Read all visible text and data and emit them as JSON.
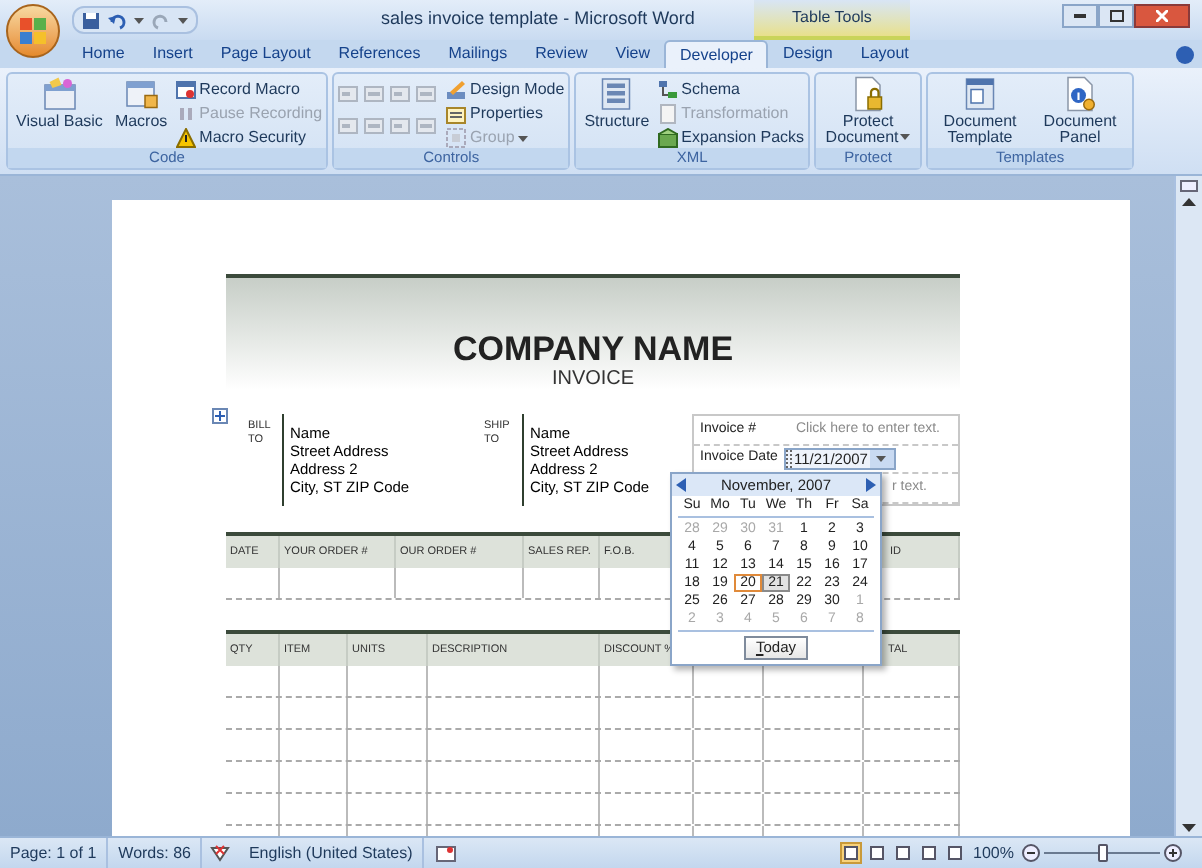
{
  "window": {
    "title": "sales invoice template - Microsoft Word",
    "context_tab": "Table Tools"
  },
  "tabs": [
    {
      "label": "Home",
      "selected": false
    },
    {
      "label": "Insert",
      "selected": false
    },
    {
      "label": "Page Layout",
      "selected": false
    },
    {
      "label": "References",
      "selected": false
    },
    {
      "label": "Mailings",
      "selected": false
    },
    {
      "label": "Review",
      "selected": false
    },
    {
      "label": "View",
      "selected": false
    },
    {
      "label": "Developer",
      "selected": true
    },
    {
      "label": "Design",
      "selected": false
    },
    {
      "label": "Layout",
      "selected": false
    }
  ],
  "ribbon_groups": [
    {
      "label": "Code",
      "items": [
        {
          "label": "Visual Basic",
          "kind": "large",
          "disabled": false,
          "dropdown": false
        },
        {
          "label": "Macros",
          "kind": "large",
          "disabled": false,
          "dropdown": false
        },
        {
          "label": "Record Macro",
          "kind": "small",
          "disabled": false,
          "dropdown": false
        },
        {
          "label": "Pause Recording",
          "kind": "small",
          "disabled": true,
          "dropdown": false
        },
        {
          "label": "Macro Security",
          "kind": "small",
          "disabled": false,
          "dropdown": false
        }
      ]
    },
    {
      "label": "Controls",
      "items": [
        {
          "kind": "control_grid"
        },
        {
          "label": "Design Mode",
          "kind": "small",
          "disabled": false,
          "dropdown": false
        },
        {
          "label": "Properties",
          "kind": "small",
          "disabled": false,
          "dropdown": false
        },
        {
          "label": "Group",
          "kind": "small",
          "disabled": true,
          "dropdown": true
        }
      ]
    },
    {
      "label": "XML",
      "items": [
        {
          "label": "Structure",
          "kind": "large",
          "disabled": false,
          "dropdown": false
        },
        {
          "label": "Schema",
          "kind": "small",
          "disabled": false,
          "dropdown": false
        },
        {
          "label": "Transformation",
          "kind": "small",
          "disabled": true,
          "dropdown": false
        },
        {
          "label": "Expansion Packs",
          "kind": "small",
          "disabled": false,
          "dropdown": false
        }
      ]
    },
    {
      "label": "Protect",
      "items": [
        {
          "label": "Protect Document",
          "kind": "large",
          "disabled": false,
          "dropdown": true
        }
      ]
    },
    {
      "label": "Templates",
      "items": [
        {
          "label": "Document Template",
          "kind": "large",
          "disabled": false,
          "dropdown": false
        },
        {
          "label": "Document Panel",
          "kind": "large",
          "disabled": false,
          "dropdown": false
        }
      ]
    }
  ],
  "document": {
    "company_name": "COMPANY NAME",
    "title": "INVOICE",
    "bill_to": {
      "label": "BILL TO",
      "lines": [
        "Name",
        "Street Address",
        "Address 2",
        "City, ST  ZIP Code"
      ]
    },
    "ship_to": {
      "label": "SHIP TO",
      "lines": [
        "Name",
        "Street Address",
        "Address 2",
        "City, ST  ZIP Code"
      ]
    },
    "invoice_fields": [
      {
        "label": "Invoice #",
        "value": "Click here to enter text.",
        "kind": "text"
      },
      {
        "label": "Invoice Date",
        "value": "11/21/2007",
        "kind": "date"
      },
      {
        "value": "r text.",
        "kind": "text"
      }
    ],
    "order_table": {
      "columns": [
        "DATE",
        "YOUR ORDER #",
        "OUR ORDER #",
        "SALES REP.",
        "F.O.B.",
        null,
        "ID"
      ]
    },
    "items_table": {
      "columns": [
        "QTY",
        "ITEM",
        "UNITS",
        "DESCRIPTION",
        "DISCOUNT %",
        null,
        null,
        "TAL"
      ]
    }
  },
  "date_picker": {
    "month": "November, 2007",
    "weekdays": [
      "Su",
      "Mo",
      "Tu",
      "We",
      "Th",
      "Fr",
      "Sa"
    ],
    "today_button": "Today",
    "weeks": [
      [
        {
          "day": "28",
          "outside": true,
          "selected": false,
          "today": false
        },
        {
          "day": "29",
          "outside": true,
          "selected": false,
          "today": false
        },
        {
          "day": "30",
          "outside": true,
          "selected": false,
          "today": false
        },
        {
          "day": "31",
          "outside": true,
          "selected": false,
          "today": false
        },
        {
          "day": "1",
          "outside": false,
          "selected": false,
          "today": false
        },
        {
          "day": "2",
          "outside": false,
          "selected": false,
          "today": false
        },
        {
          "day": "3",
          "outside": false,
          "selected": false,
          "today": false
        }
      ],
      [
        {
          "day": "4",
          "outside": false,
          "selected": false,
          "today": false
        },
        {
          "day": "5",
          "outside": false,
          "selected": false,
          "today": false
        },
        {
          "day": "6",
          "outside": false,
          "selected": false,
          "today": false
        },
        {
          "day": "7",
          "outside": false,
          "selected": false,
          "today": false
        },
        {
          "day": "8",
          "outside": false,
          "selected": false,
          "today": false
        },
        {
          "day": "9",
          "outside": false,
          "selected": false,
          "today": false
        },
        {
          "day": "10",
          "outside": false,
          "selected": false,
          "today": false
        }
      ],
      [
        {
          "day": "11",
          "outside": false,
          "selected": false,
          "today": false
        },
        {
          "day": "12",
          "outside": false,
          "selected": false,
          "today": false
        },
        {
          "day": "13",
          "outside": false,
          "selected": false,
          "today": false
        },
        {
          "day": "14",
          "outside": false,
          "selected": false,
          "today": false
        },
        {
          "day": "15",
          "outside": false,
          "selected": false,
          "today": false
        },
        {
          "day": "16",
          "outside": false,
          "selected": false,
          "today": false
        },
        {
          "day": "17",
          "outside": false,
          "selected": false,
          "today": false
        }
      ],
      [
        {
          "day": "18",
          "outside": false,
          "selected": false,
          "today": false
        },
        {
          "day": "19",
          "outside": false,
          "selected": false,
          "today": false
        },
        {
          "day": "20",
          "outside": false,
          "selected": false,
          "today": true
        },
        {
          "day": "21",
          "outside": false,
          "selected": true,
          "today": false
        },
        {
          "day": "22",
          "outside": false,
          "selected": false,
          "today": false
        },
        {
          "day": "23",
          "outside": false,
          "selected": false,
          "today": false
        },
        {
          "day": "24",
          "outside": false,
          "selected": false,
          "today": false
        }
      ],
      [
        {
          "day": "25",
          "outside": false,
          "selected": false,
          "today": false
        },
        {
          "day": "26",
          "outside": false,
          "selected": false,
          "today": false
        },
        {
          "day": "27",
          "outside": false,
          "selected": false,
          "today": false
        },
        {
          "day": "28",
          "outside": false,
          "selected": false,
          "today": false
        },
        {
          "day": "29",
          "outside": false,
          "selected": false,
          "today": false
        },
        {
          "day": "30",
          "outside": false,
          "selected": false,
          "today": false
        },
        {
          "day": "1",
          "outside": true,
          "selected": false,
          "today": false
        }
      ],
      [
        {
          "day": "2",
          "outside": true,
          "selected": false,
          "today": false
        },
        {
          "day": "3",
          "outside": true,
          "selected": false,
          "today": false
        },
        {
          "day": "4",
          "outside": true,
          "selected": false,
          "today": false
        },
        {
          "day": "5",
          "outside": true,
          "selected": false,
          "today": false
        },
        {
          "day": "6",
          "outside": true,
          "selected": false,
          "today": false
        },
        {
          "day": "7",
          "outside": true,
          "selected": false,
          "today": false
        },
        {
          "day": "8",
          "outside": true,
          "selected": false,
          "today": false
        }
      ]
    ]
  },
  "status": {
    "items": [
      "Page: 1 of 1",
      "Words: 86",
      "English (United States)"
    ],
    "zoom": "100%",
    "zoom_slider": {
      "level": 0.5
    }
  }
}
